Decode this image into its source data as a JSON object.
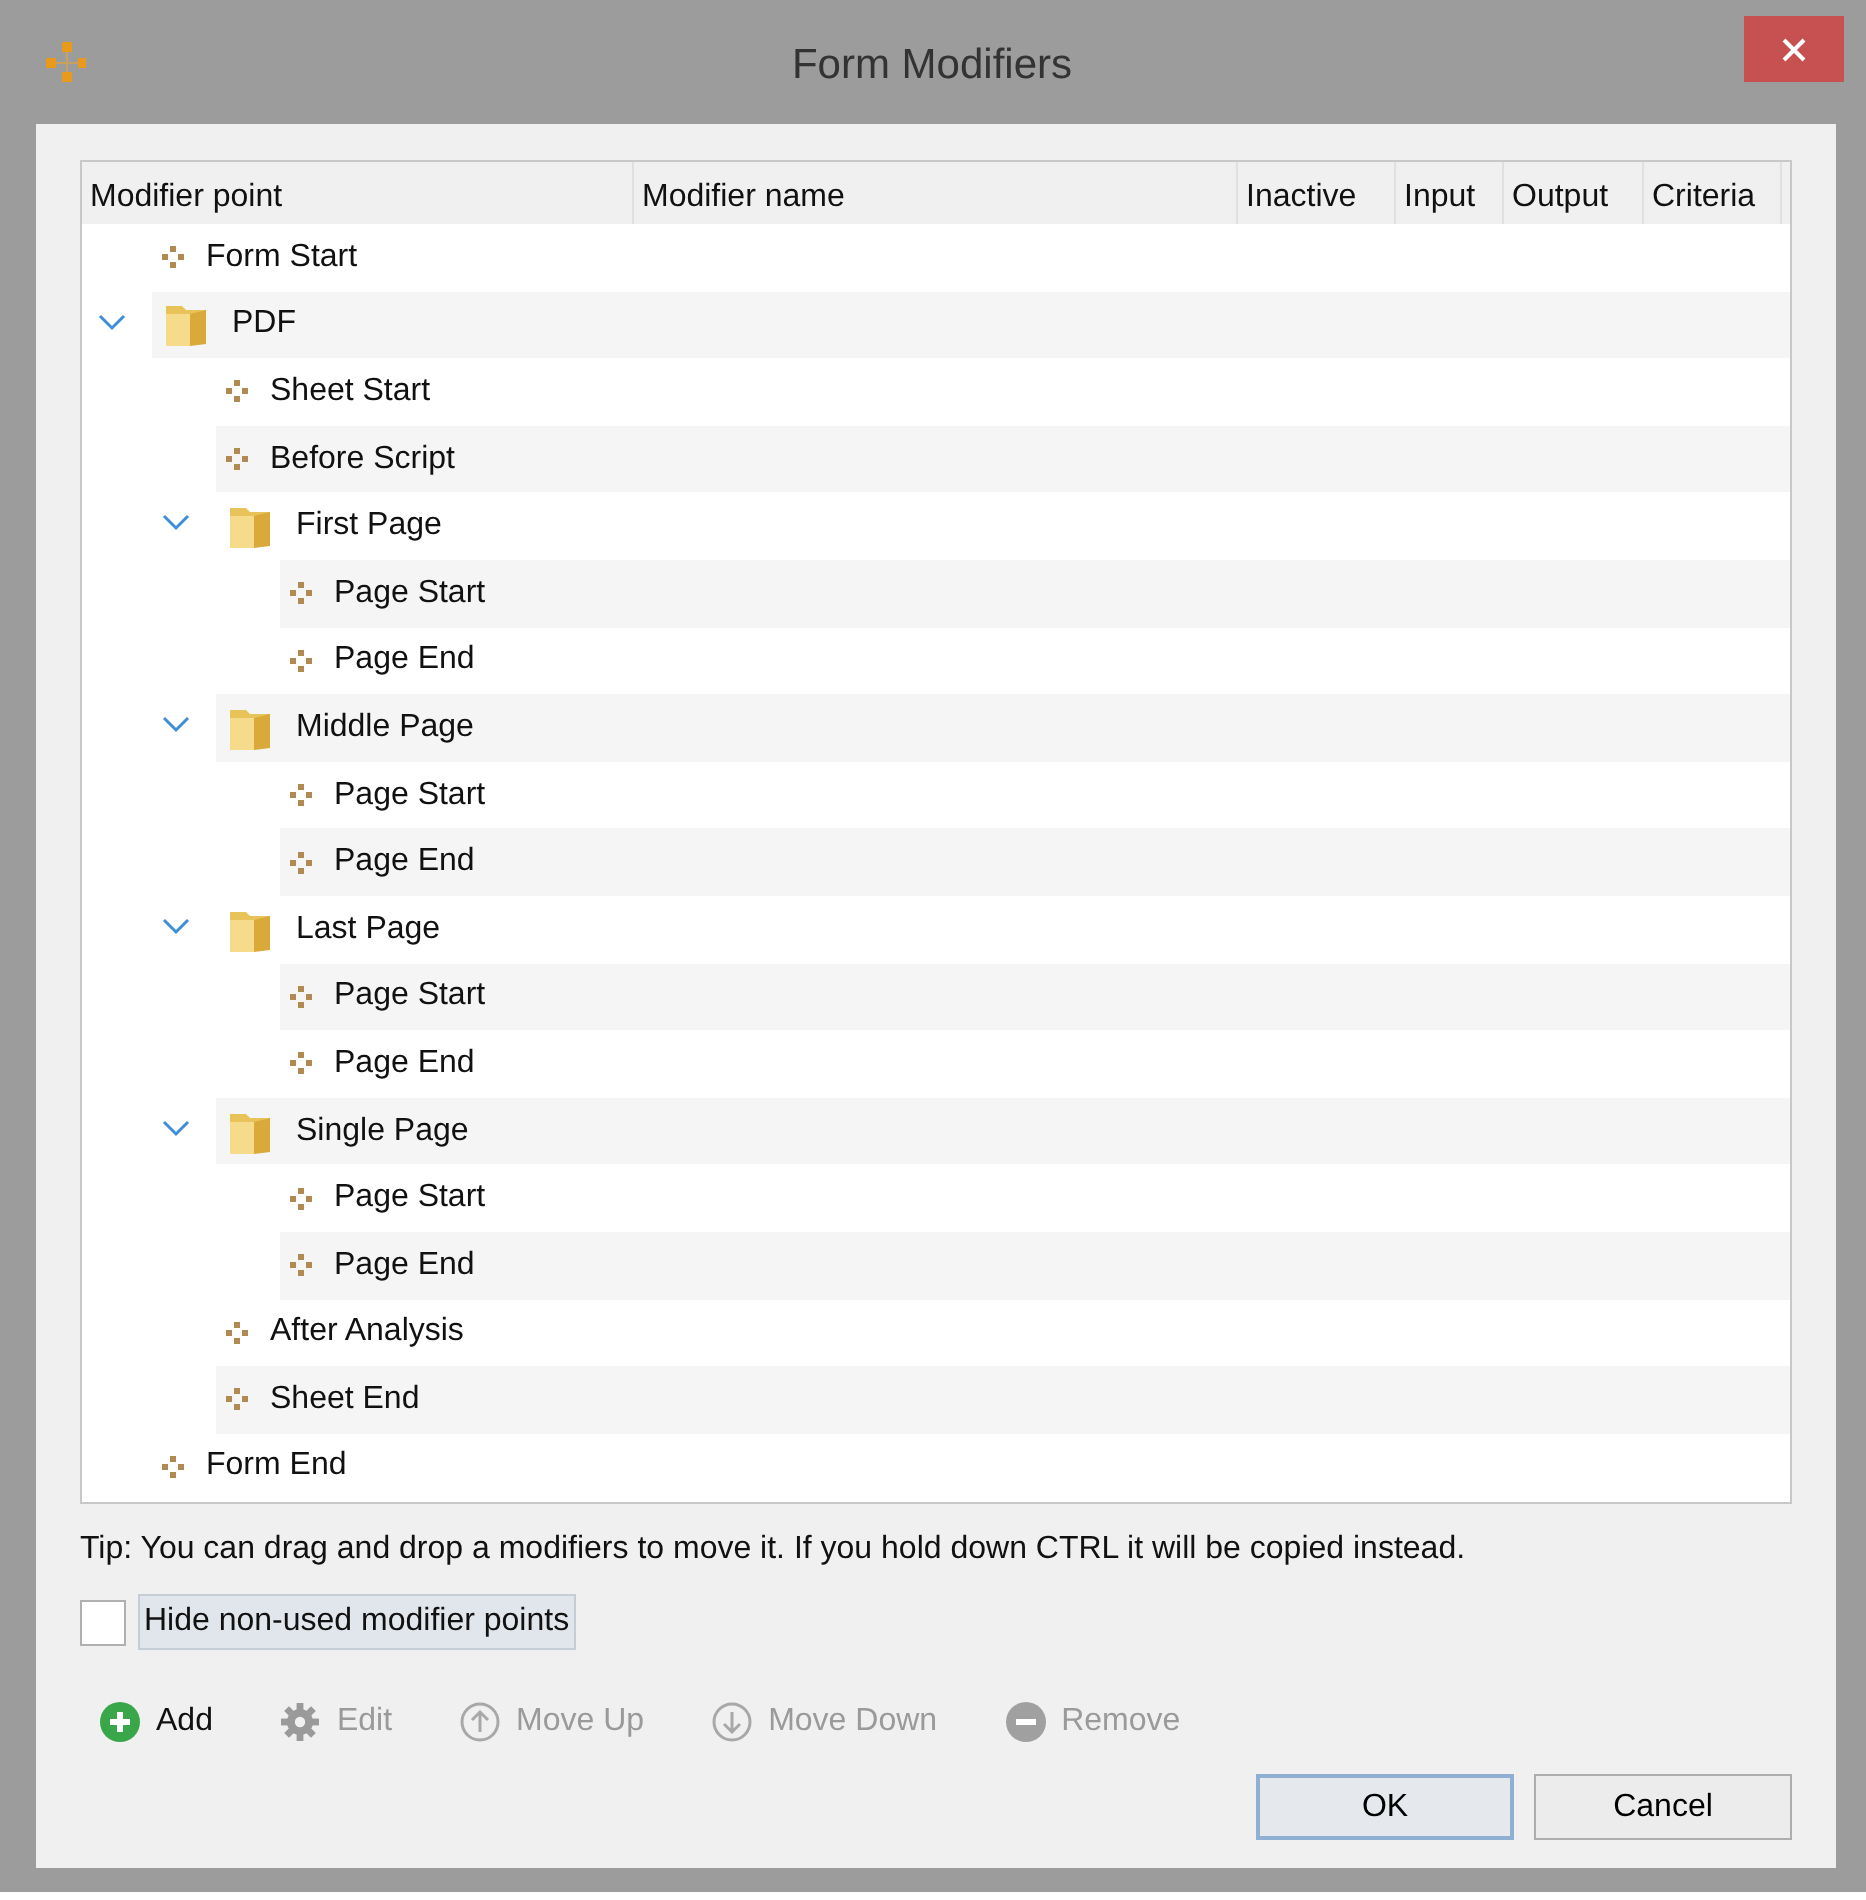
{
  "window": {
    "title": "Form Modifiers"
  },
  "table": {
    "columns": [
      "Modifier point",
      "Modifier name",
      "Inactive",
      "Input",
      "Output",
      "Criteria"
    ],
    "tree": [
      {
        "kind": "point",
        "label": "Form Start"
      },
      {
        "kind": "folder",
        "label": "PDF",
        "expanded": true,
        "children": [
          {
            "kind": "point",
            "label": "Sheet Start"
          },
          {
            "kind": "point",
            "label": "Before Script"
          },
          {
            "kind": "folder",
            "label": "First Page",
            "expanded": true,
            "children": [
              {
                "kind": "point",
                "label": "Page Start"
              },
              {
                "kind": "point",
                "label": "Page End"
              }
            ]
          },
          {
            "kind": "folder",
            "label": "Middle Page",
            "expanded": true,
            "children": [
              {
                "kind": "point",
                "label": "Page Start"
              },
              {
                "kind": "point",
                "label": "Page End"
              }
            ]
          },
          {
            "kind": "folder",
            "label": "Last Page",
            "expanded": true,
            "children": [
              {
                "kind": "point",
                "label": "Page Start"
              },
              {
                "kind": "point",
                "label": "Page End"
              }
            ]
          },
          {
            "kind": "folder",
            "label": "Single Page",
            "expanded": true,
            "children": [
              {
                "kind": "point",
                "label": "Page Start"
              },
              {
                "kind": "point",
                "label": "Page End"
              }
            ]
          },
          {
            "kind": "point",
            "label": "After Analysis"
          },
          {
            "kind": "point",
            "label": "Sheet End"
          }
        ]
      },
      {
        "kind": "point",
        "label": "Form End"
      }
    ]
  },
  "tip": "Tip: You can drag and drop a modifiers to move it. If you hold down CTRL it will be copied instead.",
  "checkbox": {
    "label": "Hide non-used modifier points",
    "checked": false
  },
  "toolbar": [
    {
      "kind": "add",
      "label": "Add",
      "disabled": false
    },
    {
      "kind": "edit",
      "label": "Edit",
      "disabled": true
    },
    {
      "kind": "up",
      "label": "Move Up",
      "disabled": true
    },
    {
      "kind": "down",
      "label": "Move Down",
      "disabled": true
    },
    {
      "kind": "remove",
      "label": "Remove",
      "disabled": true
    }
  ],
  "buttons": [
    {
      "label": "OK",
      "default": true
    },
    {
      "label": "Cancel",
      "default": false
    }
  ]
}
